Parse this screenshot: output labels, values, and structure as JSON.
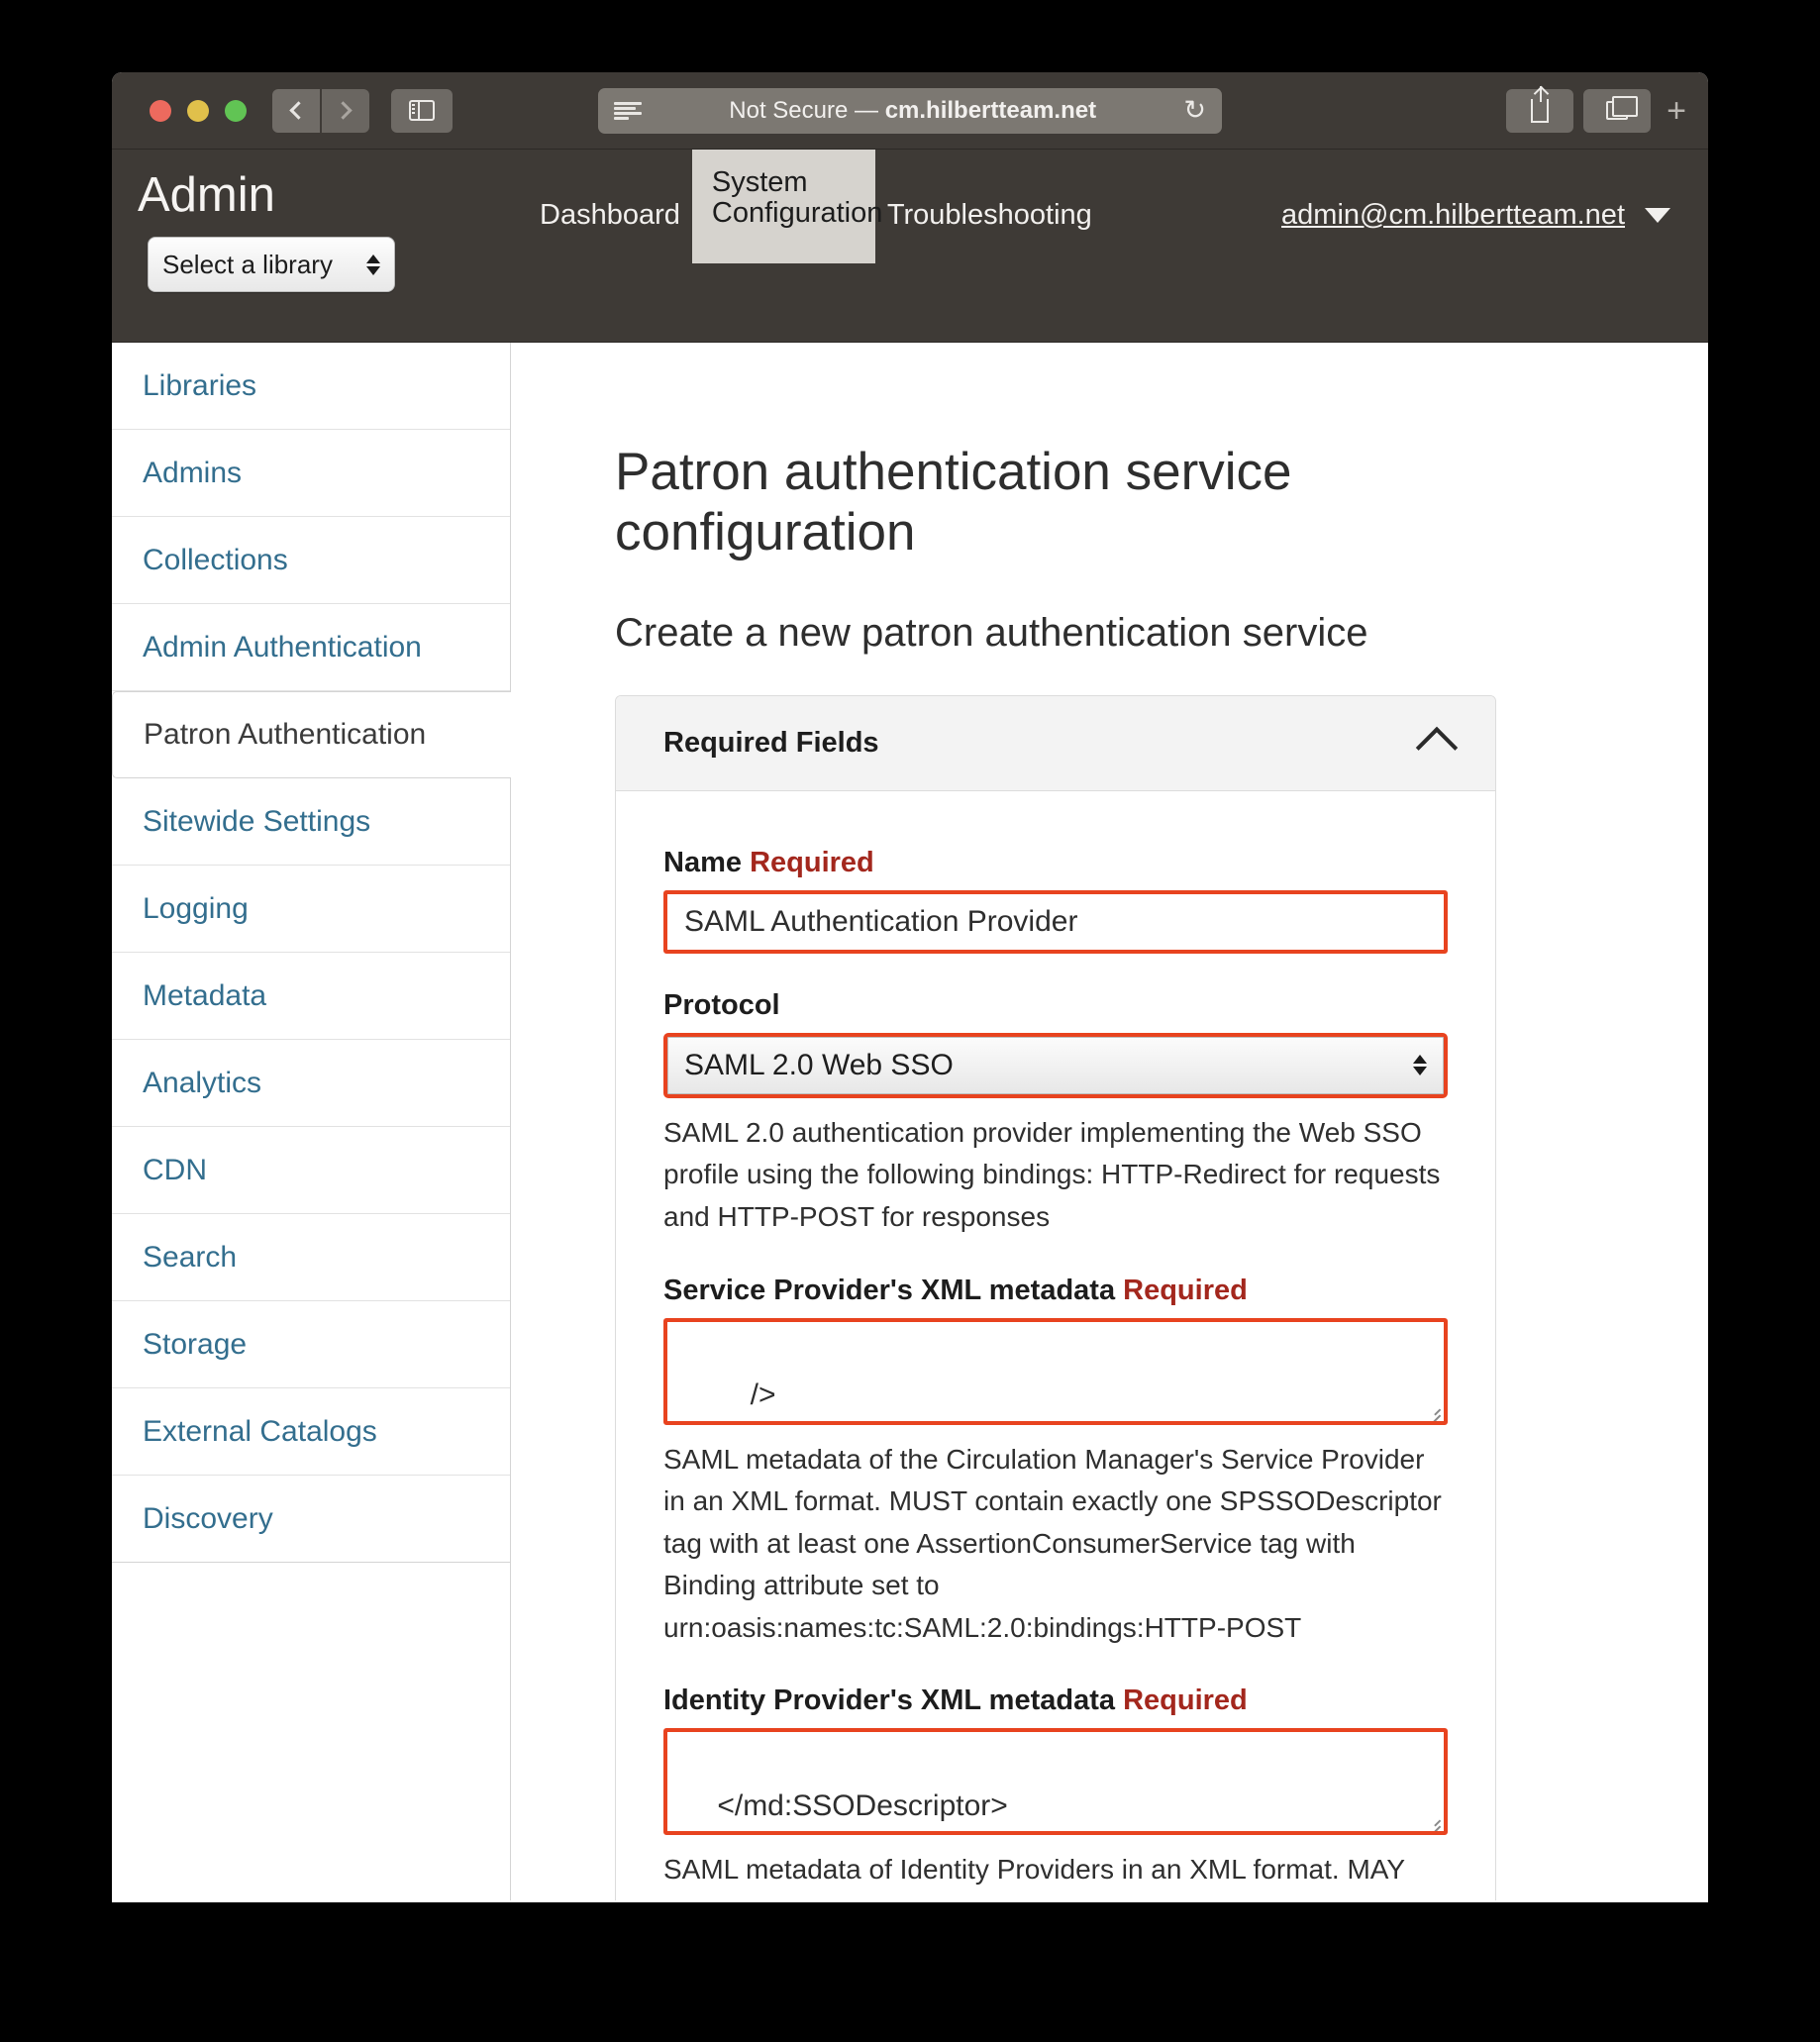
{
  "browser": {
    "url_prefix": "Not Secure — ",
    "url_domain": "cm.hilbertteam.net",
    "reload_glyph": "↻",
    "new_tab_glyph": "+"
  },
  "navbar": {
    "title": "Admin",
    "library_select_value": "Select a library",
    "links": [
      {
        "label": "Dashboard",
        "active": false
      },
      {
        "label": "System Configuration",
        "active": true
      },
      {
        "label": "Troubleshooting",
        "active": false
      }
    ],
    "user_email": "admin@cm.hilbertteam.net"
  },
  "sidebar": {
    "items": [
      {
        "label": "Libraries",
        "active": false
      },
      {
        "label": "Admins",
        "active": false
      },
      {
        "label": "Collections",
        "active": false
      },
      {
        "label": "Admin Authentication",
        "active": false
      },
      {
        "label": "Patron Authentication",
        "active": true
      },
      {
        "label": "Sitewide Settings",
        "active": false
      },
      {
        "label": "Logging",
        "active": false
      },
      {
        "label": "Metadata",
        "active": false
      },
      {
        "label": "Analytics",
        "active": false
      },
      {
        "label": "CDN",
        "active": false
      },
      {
        "label": "Search",
        "active": false
      },
      {
        "label": "Storage",
        "active": false
      },
      {
        "label": "External Catalogs",
        "active": false
      },
      {
        "label": "Discovery",
        "active": false
      }
    ]
  },
  "main": {
    "page_title": "Patron authentication service configuration",
    "page_subtitle": "Create a new patron authentication service",
    "panel": {
      "heading": "Required Fields",
      "fields": {
        "name": {
          "label": "Name",
          "required_badge": "Required",
          "value": "SAML Authentication Provider"
        },
        "protocol": {
          "label": "Protocol",
          "value": "SAML 2.0 Web SSO",
          "help": "SAML 2.0 authentication provider implementing the Web SSO profile using the following bindings: HTTP-Redirect for requests and HTTP-POST for responses"
        },
        "sp_metadata": {
          "label": "Service Provider's XML metadata",
          "required_badge": "Required",
          "value": "        />\n\n</md:EntityDescriptor>",
          "help": "SAML metadata of the Circulation Manager's Service Provider in an XML format. MUST contain exactly one SPSSODescriptor tag with at least one AssertionConsumerService tag with Binding attribute set to urn:oasis:names:tc:SAML:2.0:bindings:HTTP-POST"
        },
        "idp_metadata": {
          "label": "Identity Provider's XML metadata",
          "required_badge": "Required",
          "value": "    </md:SSODescriptor>\n    </IDPSSODescriptor>\n</EntityDescriptor>",
          "help": "SAML metadata of Identity Providers in an XML format. MAY"
        }
      }
    }
  },
  "colors": {
    "accent_red": "#e8431f",
    "required_red": "#a3271d",
    "link_blue": "#336e8e",
    "chrome_dark": "#3e3a36"
  }
}
